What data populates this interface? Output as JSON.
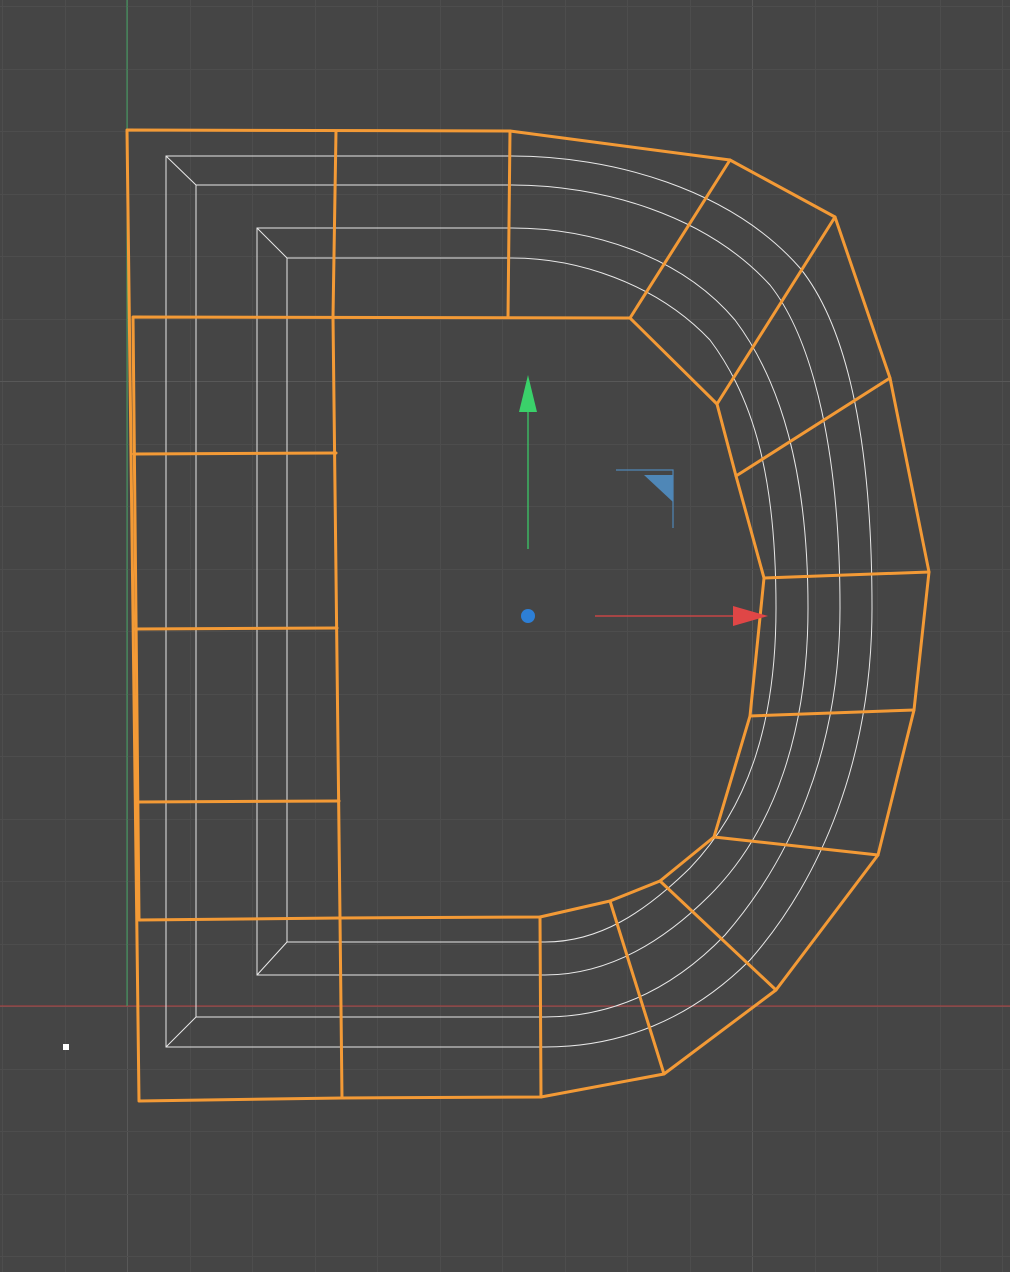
{
  "viewport": {
    "background": "#454545",
    "grid_minor_color": "#4d4d4d",
    "grid_major_color": "#585858",
    "x_axis_color": "#b34040",
    "y_axis_color": "#3fa060"
  },
  "mesh": {
    "letter": "D",
    "selection_color": "#f39a36",
    "inner_wire_color": "#e8e8e8"
  },
  "gizmo": {
    "x_axis_color": "#e04646",
    "y_axis_color": "#3ad16a",
    "plane_handle_color": "#4f87b7",
    "pivot_color": "#2d7fd6"
  }
}
